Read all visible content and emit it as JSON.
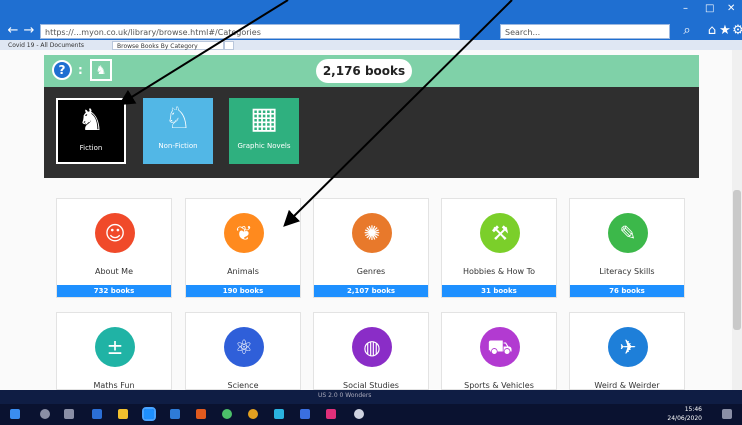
{
  "browser": {
    "url": "https://...myon.co.uk/library/browse.html#/Categories",
    "search_placeholder": "Search...",
    "tabs": [
      {
        "label": "Covid 19 - All Documents"
      },
      {
        "label": "Browse Books By Category",
        "active": true
      }
    ],
    "window_controls": [
      "–",
      "□",
      "✕"
    ]
  },
  "library": {
    "book_count": "2,176 books",
    "categories": [
      {
        "label": "Fiction",
        "icon": "unicorn-icon",
        "selected": true
      },
      {
        "label": "Non-Fiction",
        "icon": "horse-icon"
      },
      {
        "label": "Graphic Novels",
        "icon": "comic-icon"
      }
    ]
  },
  "subjects": [
    {
      "title": "About Me",
      "count": "732 books",
      "color": "#f04a2a",
      "icon": "person-icon"
    },
    {
      "title": "Animals",
      "count": "190 books",
      "color": "#ff8a1e",
      "icon": "paw-icon"
    },
    {
      "title": "Genres",
      "count": "2,107 books",
      "color": "#e8792b",
      "icon": "genres-icon"
    },
    {
      "title": "Hobbies & How To",
      "count": "31 books",
      "color": "#7bcf2a",
      "icon": "hammer-icon"
    },
    {
      "title": "Literacy Skills",
      "count": "76 books",
      "color": "#3cb84a",
      "icon": "pencil-icon"
    },
    {
      "title": "Maths Fun",
      "color": "#20b3a5",
      "icon": "math-icon"
    },
    {
      "title": "Science",
      "color": "#2f5fd9",
      "icon": "atom-icon"
    },
    {
      "title": "Social Studies",
      "color": "#8a2dc7",
      "icon": "globe-icon"
    },
    {
      "title": "Sports & Vehicles",
      "color": "#b23ad1",
      "icon": "vehicle-icon"
    },
    {
      "title": "Weird & Weirder",
      "color": "#1e7fd9",
      "icon": "weird-icon"
    }
  ],
  "status_text": "US 2.0 0 Wonders",
  "taskbar": {
    "time": "15:46",
    "date": "24/06/2020"
  },
  "colors": {
    "header_green": "#7fd1a8",
    "dark_band": "#2f2f2f",
    "count_bar_blue": "#1e90ff",
    "browser_blue": "#1f6fd1"
  }
}
